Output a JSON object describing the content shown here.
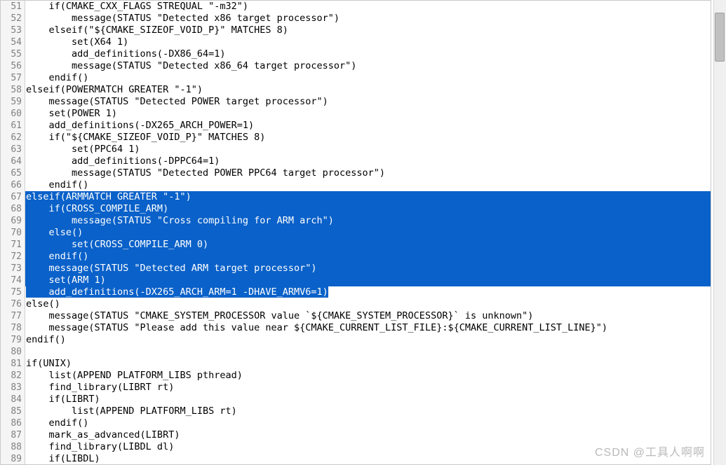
{
  "editor": {
    "first_line": 51,
    "selection_start": 67,
    "selection_end_line": 75,
    "selection_end_text": "    add_definitions(-DX265_ARCH_ARM=1 -DHAVE_ARMV6=1)",
    "lines": [
      "    if(CMAKE_CXX_FLAGS STREQUAL \"-m32\")",
      "        message(STATUS \"Detected x86 target processor\")",
      "    elseif(\"${CMAKE_SIZEOF_VOID_P}\" MATCHES 8)",
      "        set(X64 1)",
      "        add_definitions(-DX86_64=1)",
      "        message(STATUS \"Detected x86_64 target processor\")",
      "    endif()",
      "elseif(POWERMATCH GREATER \"-1\")",
      "    message(STATUS \"Detected POWER target processor\")",
      "    set(POWER 1)",
      "    add_definitions(-DX265_ARCH_POWER=1)",
      "    if(\"${CMAKE_SIZEOF_VOID_P}\" MATCHES 8)",
      "        set(PPC64 1)",
      "        add_definitions(-DPPC64=1)",
      "        message(STATUS \"Detected POWER PPC64 target processor\")",
      "    endif()",
      "elseif(ARMMATCH GREATER \"-1\")",
      "    if(CROSS_COMPILE_ARM)",
      "        message(STATUS \"Cross compiling for ARM arch\")",
      "    else()",
      "        set(CROSS_COMPILE_ARM 0)",
      "    endif()",
      "    message(STATUS \"Detected ARM target processor\")",
      "    set(ARM 1)",
      "    add_definitions(-DX265_ARCH_ARM=1 -DHAVE_ARMV6=1)",
      "else()",
      "    message(STATUS \"CMAKE_SYSTEM_PROCESSOR value `${CMAKE_SYSTEM_PROCESSOR}` is unknown\")",
      "    message(STATUS \"Please add this value near ${CMAKE_CURRENT_LIST_FILE}:${CMAKE_CURRENT_LIST_LINE}\")",
      "endif()",
      "",
      "if(UNIX)",
      "    list(APPEND PLATFORM_LIBS pthread)",
      "    find_library(LIBRT rt)",
      "    if(LIBRT)",
      "        list(APPEND PLATFORM_LIBS rt)",
      "    endif()",
      "    mark_as_advanced(LIBRT)",
      "    find_library(LIBDL dl)",
      "    if(LIBDL)"
    ]
  },
  "watermark": "CSDN @工具人啊啊"
}
